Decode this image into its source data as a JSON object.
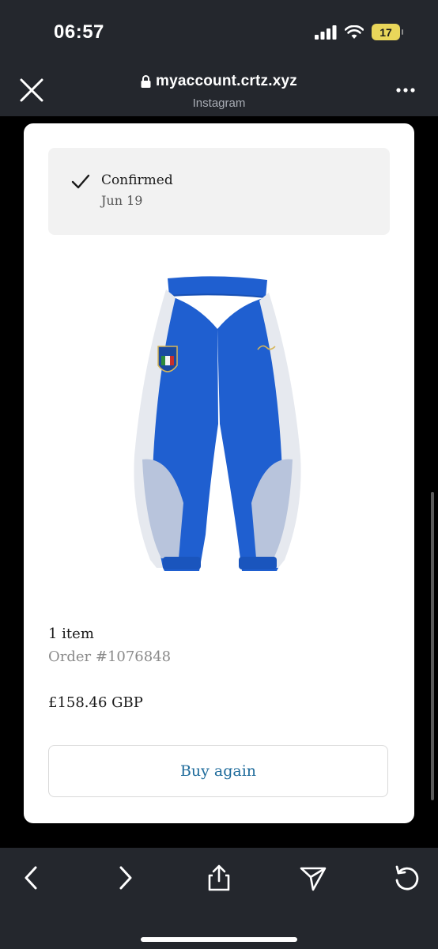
{
  "status_bar": {
    "time": "06:57",
    "battery": "17",
    "icons": [
      "signal-icon",
      "wifi-icon",
      "battery-icon"
    ]
  },
  "browser": {
    "url": "myaccount.crtz.xyz",
    "source": "Instagram",
    "icons": [
      "close-icon",
      "lock-icon",
      "more-icon"
    ]
  },
  "order": {
    "status": "Confirmed",
    "date": "Jun 19",
    "item_count": "1 item",
    "order_number": "Order #1076848",
    "total": "£158.46 GBP",
    "buy_again_label": "Buy again",
    "product_image": "blue-track-pants"
  },
  "toolbar": {
    "icons": [
      "back-icon",
      "forward-icon",
      "share-icon",
      "send-icon",
      "reload-icon"
    ]
  },
  "colors": {
    "chrome_bg": "#24272d",
    "card_bg": "#ffffff",
    "confirm_bg": "#f2f2f2",
    "link_blue": "#1e6b9b",
    "product_blue": "#1f5fd0",
    "battery": "#e9d65a"
  }
}
